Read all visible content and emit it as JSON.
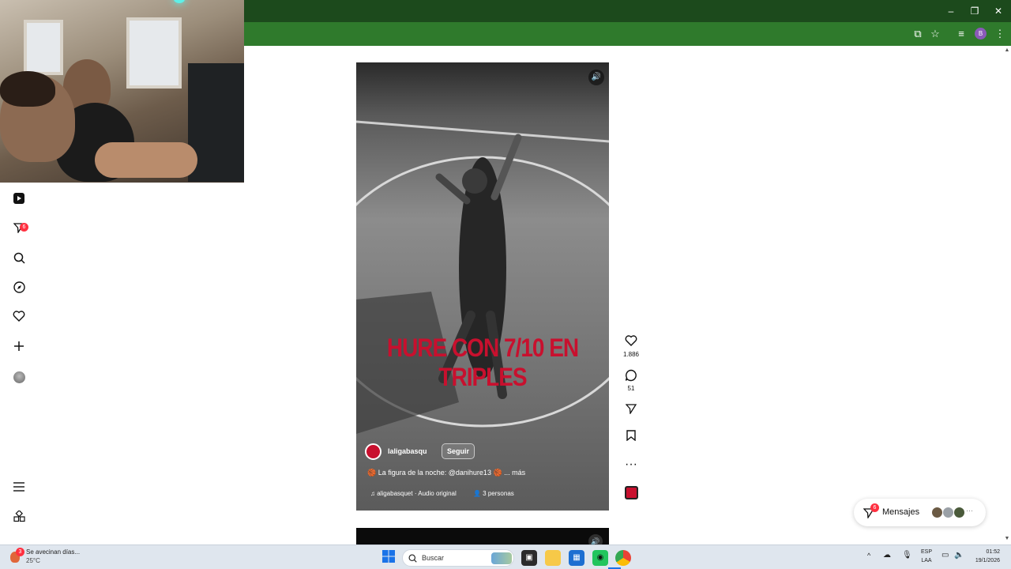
{
  "browser": {
    "window_controls": {
      "minimize": "–",
      "restore": "❐",
      "close": "✕"
    },
    "toolbar_icons": [
      "install-app-icon",
      "bookmark-star-icon",
      "media-control-icon",
      "profile-avatar-icon",
      "menu-dots-icon"
    ],
    "profile_initial": "B"
  },
  "sidebar": {
    "items": [
      {
        "name": "reels",
        "icon": "reels-icon"
      },
      {
        "name": "direct",
        "icon": "paper-plane-icon",
        "badge": "6"
      },
      {
        "name": "search",
        "icon": "search-icon"
      },
      {
        "name": "explore",
        "icon": "compass-icon"
      },
      {
        "name": "notifications",
        "icon": "heart-icon"
      },
      {
        "name": "create",
        "icon": "plus-icon"
      },
      {
        "name": "profile",
        "icon": "avatar-icon"
      }
    ],
    "bottom": [
      {
        "name": "more",
        "icon": "hamburger-icon"
      },
      {
        "name": "also-from-meta",
        "icon": "grid-icon"
      }
    ]
  },
  "reel": {
    "overlay_text": "HURE CON 7/10 EN TRIPLES",
    "author": "laligabasqu",
    "follow_label": "Seguir",
    "caption": "🏀 La figura de la noche: @danihure13 🏀 ... más",
    "audio": "♫ aligabasquet · Audio original",
    "people": "👤 3 personas"
  },
  "actions": {
    "likes": "1.886",
    "comments": "51"
  },
  "messages": {
    "label": "Mensajes",
    "badge": "6"
  },
  "taskbar": {
    "weather_text": "Se avecinan días...",
    "weather_temp": "25°C",
    "weather_badge": "3",
    "search_placeholder": "Buscar",
    "lang_1": "ESP",
    "lang_2": "LAA",
    "time": "01:52",
    "date": "19/1/2026"
  },
  "colors": {
    "titlebar": "#1c4a1c",
    "toolbar": "#2f7a2c",
    "overlay_text": "#c8102e",
    "badge": "#ff3040"
  }
}
